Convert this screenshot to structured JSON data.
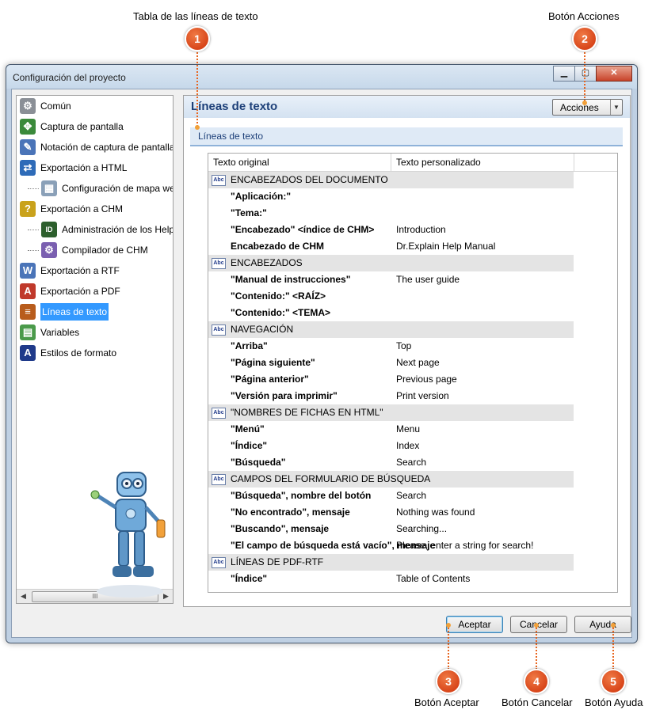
{
  "callouts": [
    {
      "number": "1",
      "label": "Tabla de las líneas de texto"
    },
    {
      "number": "2",
      "label": "Botón Acciones"
    },
    {
      "number": "3",
      "label": "Botón Aceptar"
    },
    {
      "number": "4",
      "label": "Botón Cancelar"
    },
    {
      "number": "5",
      "label": "Botón Ayuda"
    }
  ],
  "window": {
    "title": "Configuración del proyecto",
    "controls": {
      "minimize": "▁",
      "maximize": "▢",
      "close": "✕"
    }
  },
  "tree": {
    "items": [
      {
        "label": "Común",
        "icon": "gear-icon"
      },
      {
        "label": "Captura de pantalla",
        "icon": "screen-capture-icon"
      },
      {
        "label": "Notación de captura de pantalla",
        "icon": "annotation-icon"
      },
      {
        "label": "Exportación a HTML",
        "icon": "html-export-icon"
      },
      {
        "label": "Configuración de mapa web",
        "icon": "sitemap-icon"
      },
      {
        "label": "Exportación a CHM",
        "icon": "chm-export-icon"
      },
      {
        "label": "Administración de los Help IDs",
        "icon": "id-icon"
      },
      {
        "label": "Compilador de CHM",
        "icon": "compiler-icon"
      },
      {
        "label": "Exportación a RTF",
        "icon": "rtf-export-icon"
      },
      {
        "label": "Exportación a PDF",
        "icon": "pdf-export-icon"
      },
      {
        "label": "Líneas de texto",
        "icon": "text-lines-icon"
      },
      {
        "label": "Variables",
        "icon": "variables-icon"
      },
      {
        "label": "Estilos de formato",
        "icon": "format-styles-icon"
      }
    ],
    "selected": "Líneas de texto",
    "scroll_thumb": "III",
    "scroll_left": "◀",
    "scroll_right": "▶"
  },
  "panel": {
    "title": "Líneas de texto",
    "actions_label": "Acciones",
    "actions_arrow": "▼",
    "section_label": "Líneas de texto"
  },
  "table": {
    "columns": [
      "Texto original",
      "Texto personalizado"
    ],
    "group_icon_text": "Abc",
    "rows": [
      {
        "type": "group",
        "label": "ENCABEZADOS DEL DOCUMENTO"
      },
      {
        "type": "row",
        "original": "\"Aplicación:\"",
        "custom": ""
      },
      {
        "type": "row",
        "original": "\"Tema:\"",
        "custom": ""
      },
      {
        "type": "row",
        "original": "\"Encabezado\" <índice de CHM>",
        "custom": "Introduction"
      },
      {
        "type": "row",
        "original": "Encabezado de CHM",
        "custom": "Dr.Explain Help Manual"
      },
      {
        "type": "group",
        "label": "ENCABEZADOS"
      },
      {
        "type": "row",
        "original": "\"Manual de instrucciones\"",
        "custom": "The user guide"
      },
      {
        "type": "row",
        "original": "\"Contenido:\" <RAÍZ>",
        "custom": ""
      },
      {
        "type": "row",
        "original": "\"Contenido:\" <TEMA>",
        "custom": ""
      },
      {
        "type": "group",
        "label": "NAVEGACIÓN"
      },
      {
        "type": "row",
        "original": "\"Arriba\"",
        "custom": "Top"
      },
      {
        "type": "row",
        "original": "\"Página siguiente\"",
        "custom": "Next page"
      },
      {
        "type": "row",
        "original": "\"Página anterior\"",
        "custom": "Previous page"
      },
      {
        "type": "row",
        "original": "\"Versión para imprimir\"",
        "custom": "Print version"
      },
      {
        "type": "group",
        "label": "\"NOMBRES DE FICHAS EN HTML\""
      },
      {
        "type": "row",
        "original": "\"Menú\"",
        "custom": "Menu"
      },
      {
        "type": "row",
        "original": "\"Índice\"",
        "custom": "Index"
      },
      {
        "type": "row",
        "original": "\"Búsqueda\"",
        "custom": "Search"
      },
      {
        "type": "group",
        "label": "CAMPOS DEL FORMULARIO DE BÚSQUEDA"
      },
      {
        "type": "row",
        "original": "\"Búsqueda\", nombre del botón",
        "custom": "Search"
      },
      {
        "type": "row",
        "original": "\"No encontrado\", mensaje",
        "custom": "Nothing was found"
      },
      {
        "type": "row",
        "original": "\"Buscando\", mensaje",
        "custom": "Searching..."
      },
      {
        "type": "row",
        "original": "\"El campo de búsqueda está vacío\", mensaje",
        "custom": "Please, enter a string for search!"
      },
      {
        "type": "group",
        "label": "LÍNEAS DE PDF-RTF"
      },
      {
        "type": "row",
        "original": "\"Índice\"",
        "custom": "Table of Contents"
      }
    ]
  },
  "buttons": {
    "accept": "Aceptar",
    "cancel": "Cancelar",
    "help": "Ayuda"
  }
}
